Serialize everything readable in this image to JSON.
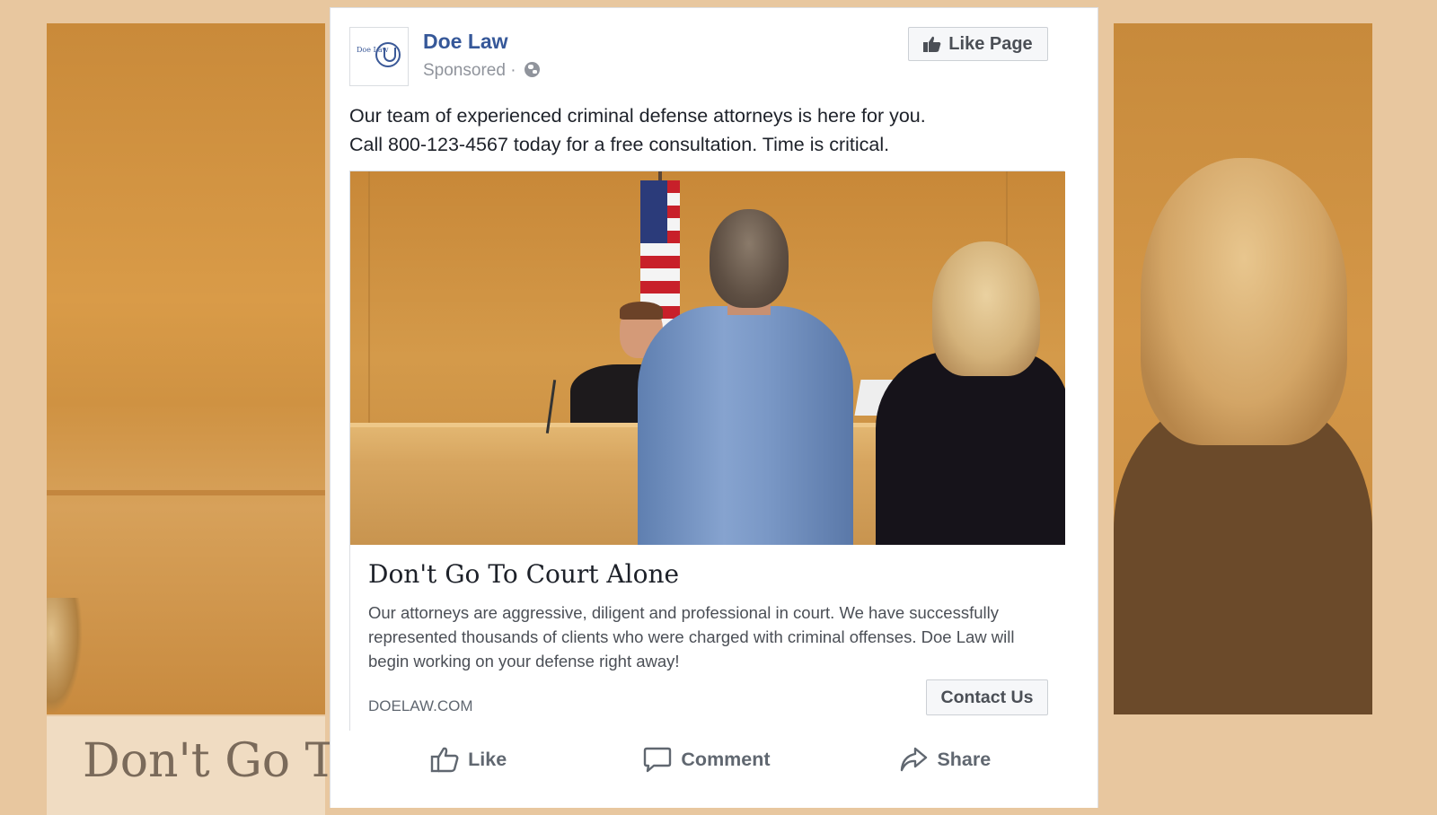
{
  "background": {
    "title_fragment": "Don't Go T"
  },
  "post": {
    "page_name": "Doe Law",
    "logo_text": "Doe Law",
    "sponsored_label": "Sponsored",
    "separator": "·",
    "like_page_label": "Like Page",
    "text_line1": "Our team of experienced criminal defense attorneys is here for you.",
    "text_line2": "Call 800-123-4567 today for a free consultation. Time is critical."
  },
  "link_preview": {
    "headline": "Don't Go To Court Alone",
    "description": "Our attorneys are aggressive, diligent and professional in court. We have successfully represented thousands of clients who were charged with criminal offenses. Doe Law will begin working on your defense right away!",
    "domain": "DOELAW.COM",
    "cta_label": "Contact Us"
  },
  "actions": {
    "like_label": "Like",
    "comment_label": "Comment",
    "share_label": "Share"
  },
  "icons": [
    "thumbs-up-icon",
    "globe-icon",
    "comment-icon",
    "share-icon"
  ],
  "colors": {
    "link_blue": "#365899",
    "text": "#1d2129",
    "muted": "#90949c",
    "background": "#e8c79f"
  }
}
